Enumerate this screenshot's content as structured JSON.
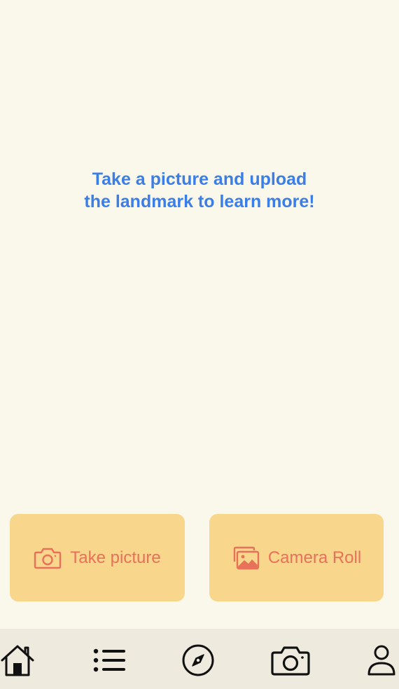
{
  "prompt": {
    "line1": "Take a picture and upload",
    "line2": "the landmark to learn more!"
  },
  "actions": {
    "take_picture_label": "Take picture",
    "take_picture_icon": "camera-icon",
    "camera_roll_label": "Camera Roll",
    "camera_roll_icon": "photo-gallery-icon"
  },
  "tabbar": {
    "items": [
      {
        "icon": "house-icon",
        "active": true
      },
      {
        "icon": "list-icon",
        "active": false
      },
      {
        "icon": "compass-icon",
        "active": false
      },
      {
        "icon": "camera-icon",
        "active": false
      },
      {
        "icon": "person-icon",
        "active": false
      }
    ]
  },
  "colors": {
    "background": "#FAF7EB",
    "prompt_text": "#3C7EE8",
    "button_fill": "#F8D68C",
    "button_text": "#E8715A",
    "tabbar_background": "#EEEADD",
    "tab_icon": "#111111"
  }
}
